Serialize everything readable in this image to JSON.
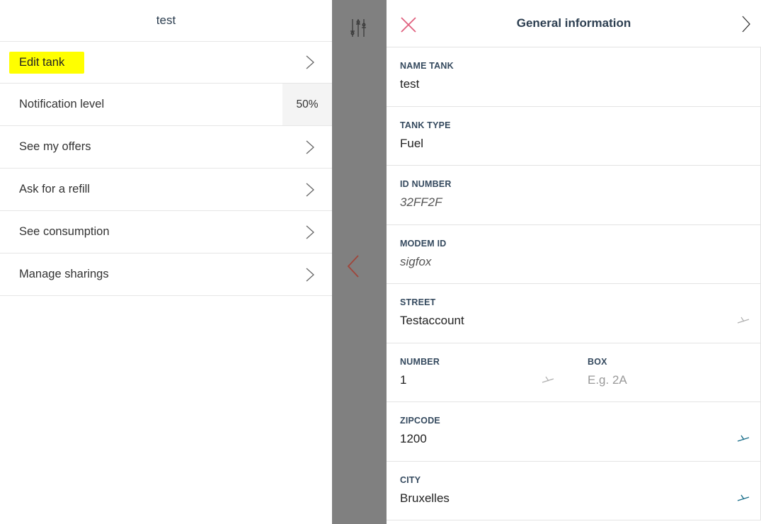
{
  "left": {
    "title": "test",
    "items": [
      {
        "label": "Edit tank"
      },
      {
        "label": "Notification level",
        "value": "50%"
      },
      {
        "label": "See my offers"
      },
      {
        "label": "Ask for a refill"
      },
      {
        "label": "See consumption"
      },
      {
        "label": "Manage sharings"
      }
    ]
  },
  "right": {
    "title": "General information",
    "fields": {
      "name_tank": {
        "label": "NAME TANK",
        "value": "test"
      },
      "tank_type": {
        "label": "TANK TYPE",
        "value": "Fuel"
      },
      "id_number": {
        "label": "ID NUMBER",
        "value": "32FF2F"
      },
      "modem_id": {
        "label": "MODEM ID",
        "value": "sigfox"
      },
      "street": {
        "label": "STREET",
        "value": "Testaccount"
      },
      "number": {
        "label": "NUMBER",
        "value": "1"
      },
      "box": {
        "label": "BOX",
        "placeholder": "E.g. 2A"
      },
      "zipcode": {
        "label": "ZIPCODE",
        "value": "1200"
      },
      "city": {
        "label": "CITY",
        "value": "Bruxelles"
      }
    }
  },
  "colors": {
    "highlight": "#ffff00",
    "strip": "#808080",
    "close": "#e0607e",
    "back_chevron": "#a0453a",
    "edit_active": "#1a6e8a",
    "edit_inactive": "#b0b0b0",
    "title": "#2c3e50"
  }
}
